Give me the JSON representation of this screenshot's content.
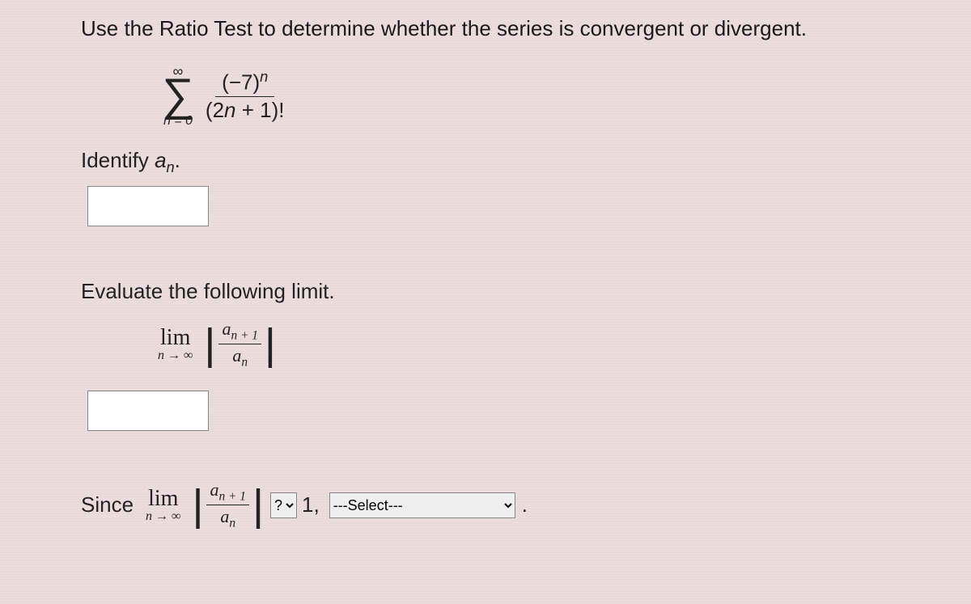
{
  "question": "Use the Ratio Test to determine whether the series is convergent or divergent.",
  "series": {
    "upper": "∞",
    "lower": "n = 0",
    "numerator_base": "(−7)",
    "numerator_exp": "n",
    "denominator": "(2n + 1)!"
  },
  "identify": {
    "label_prefix": "Identify ",
    "var": "a",
    "var_sub": "n",
    "label_suffix": "."
  },
  "evaluate": {
    "label": "Evaluate the following limit.",
    "lim": "lim",
    "lim_sub": "n → ∞",
    "ratio_num_a": "a",
    "ratio_num_sub": "n + 1",
    "ratio_den_a": "a",
    "ratio_den_sub": "n"
  },
  "since": {
    "word": "Since",
    "lim": "lim",
    "lim_sub": "n → ∞",
    "ratio_num_a": "a",
    "ratio_num_sub": "n + 1",
    "ratio_den_a": "a",
    "ratio_den_sub": "n",
    "compare_placeholder": "?",
    "one_text": "1,",
    "conclusion_placeholder": "---Select---",
    "period": "."
  }
}
